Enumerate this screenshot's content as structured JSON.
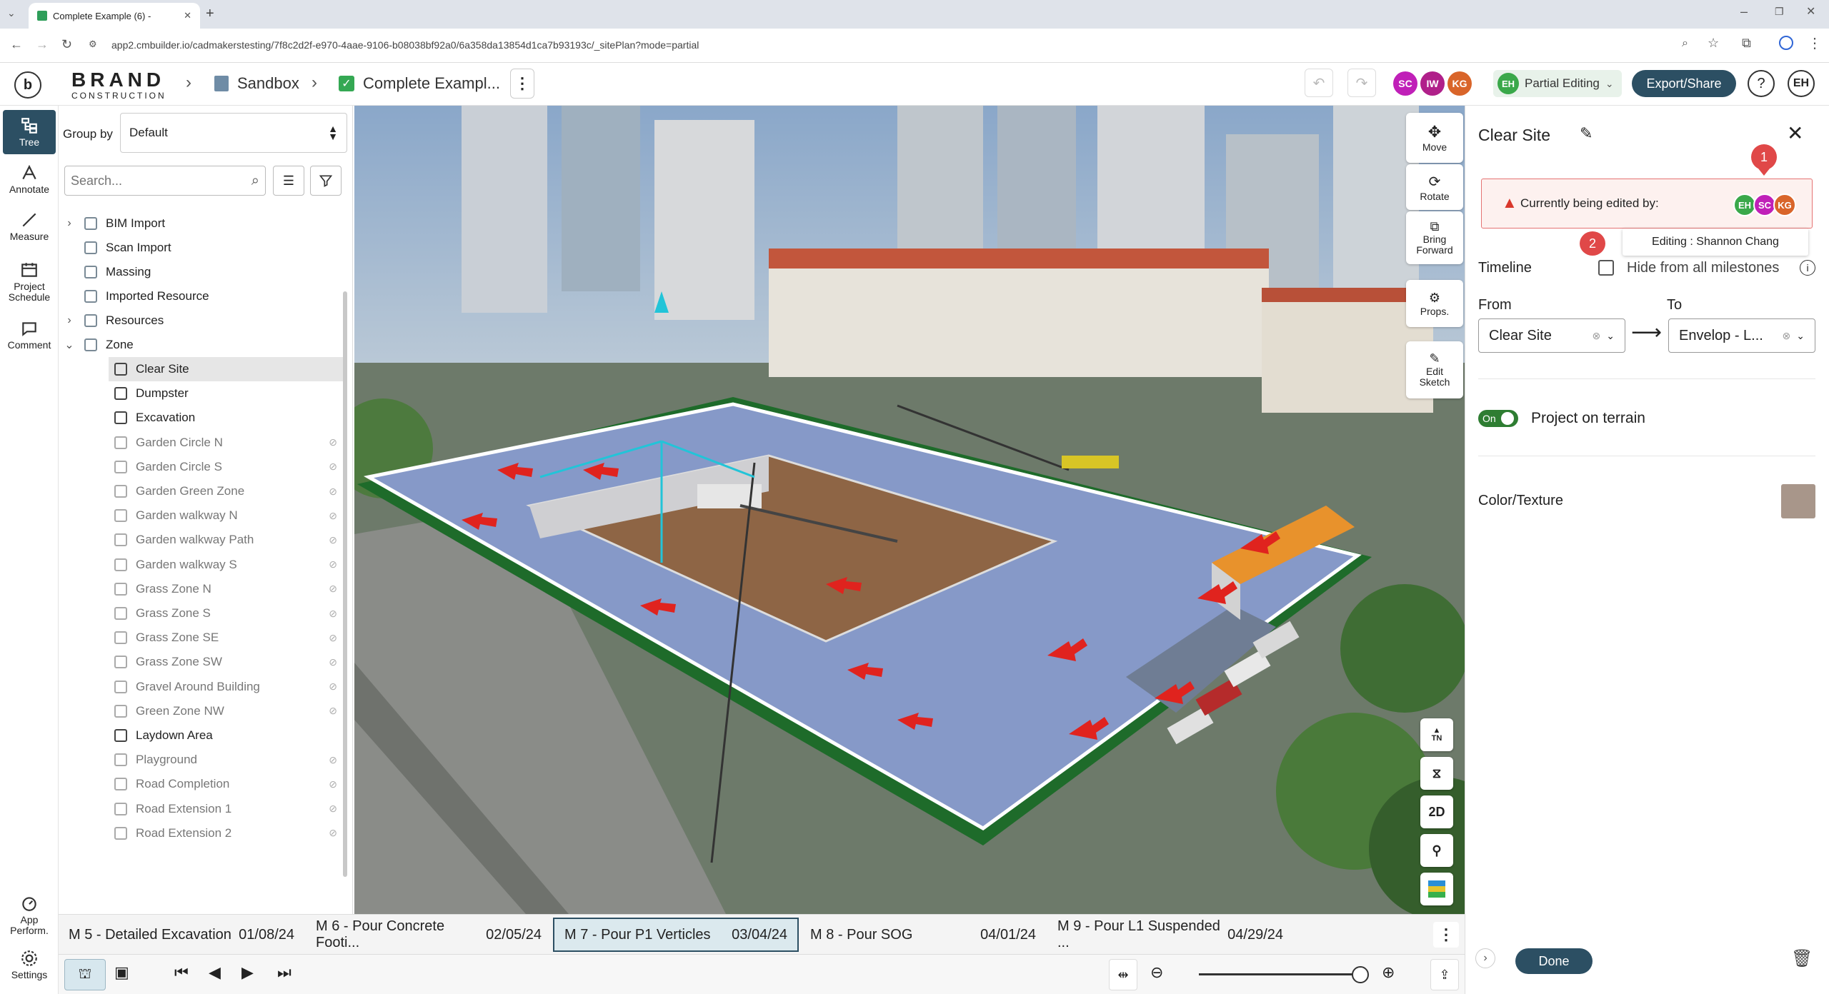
{
  "browser": {
    "tab_title": "Complete Example (6) -",
    "url": "app2.cmbuilder.io/cadmakerstesting/7f8c2d2f-e970-4aae-9106-b08038bf92a0/6a358da13854d1ca7b93193c/_sitePlan?mode=partial"
  },
  "header": {
    "logo_top": "BRAND",
    "logo_bottom": "CONSTRUCTION",
    "crumb1": "Sandbox",
    "crumb2": "Complete Exampl...",
    "avatars": [
      "SC",
      "IW",
      "KG"
    ],
    "editing_mode_initials": "EH",
    "editing_mode_label": "Partial Editing",
    "export_label": "Export/Share",
    "help_label": "?",
    "user_initials": "EH"
  },
  "rail": {
    "tree": "Tree",
    "annotate": "Annotate",
    "measure": "Measure",
    "schedule": "Project Schedule",
    "comment": "Comment",
    "perf": "App Perform.",
    "settings": "Settings"
  },
  "tree": {
    "group_by_label": "Group by",
    "group_by_value": "Default",
    "search_placeholder": "Search...",
    "top_items": [
      {
        "label": "BIM Import",
        "expand": true
      },
      {
        "label": "Scan Import",
        "expand": false
      },
      {
        "label": "Massing",
        "expand": false
      },
      {
        "label": "Imported Resource",
        "expand": false
      },
      {
        "label": "Resources",
        "expand": true
      },
      {
        "label": "Zone",
        "expand": true
      }
    ],
    "zone_children": [
      {
        "label": "Clear Site",
        "dim": false,
        "selected": true
      },
      {
        "label": "Dumpster",
        "dim": false
      },
      {
        "label": "Excavation",
        "dim": false
      },
      {
        "label": "Garden Circle N",
        "dim": true
      },
      {
        "label": "Garden Circle S",
        "dim": true
      },
      {
        "label": "Garden Green Zone",
        "dim": true
      },
      {
        "label": "Garden walkway N",
        "dim": true
      },
      {
        "label": "Garden walkway Path",
        "dim": true
      },
      {
        "label": "Garden walkway S",
        "dim": true
      },
      {
        "label": "Grass Zone N",
        "dim": true
      },
      {
        "label": "Grass Zone S",
        "dim": true
      },
      {
        "label": "Grass Zone SE",
        "dim": true
      },
      {
        "label": "Grass Zone SW",
        "dim": true
      },
      {
        "label": "Gravel Around Building",
        "dim": true
      },
      {
        "label": "Green Zone NW",
        "dim": true
      },
      {
        "label": "Laydown Area",
        "dim": false
      },
      {
        "label": "Playground",
        "dim": true
      },
      {
        "label": "Road Completion",
        "dim": true
      },
      {
        "label": "Road Extension 1",
        "dim": true
      },
      {
        "label": "Road Extension 2",
        "dim": true
      }
    ]
  },
  "tools": {
    "move": "Move",
    "rotate": "Rotate",
    "bring_forward": "Bring Forward",
    "props": "Props.",
    "edit_sketch": "Edit Sketch",
    "tn": "TN",
    "two_d": "2D"
  },
  "panel": {
    "title": "Clear Site",
    "editing_banner": "Currently being edited by:",
    "editor_avatars": [
      "EH",
      "SC",
      "KG"
    ],
    "tooltip": "Editing : Shannon Chang",
    "marker1": "1",
    "marker2": "2",
    "timeline_label": "Timeline",
    "hide_label": "Hide from all milestones",
    "from_label": "From",
    "to_label": "To",
    "from_value": "Clear Site",
    "to_value": "Envelop - L...",
    "toggle_label": "On",
    "terrain_label": "Project on terrain",
    "color_label": "Color/Texture",
    "done_label": "Done"
  },
  "milestones": [
    {
      "name": "M 5 - Detailed Excavation",
      "date": "01/08/24",
      "active": false
    },
    {
      "name": "M 6 - Pour Concrete Footi...",
      "date": "02/05/24",
      "active": false
    },
    {
      "name": "M 7 - Pour P1 Verticles",
      "date": "03/04/24",
      "active": true
    },
    {
      "name": "M 8 - Pour SOG",
      "date": "04/01/24",
      "active": false
    },
    {
      "name": "M 9 - Pour L1 Suspended ...",
      "date": "04/29/24",
      "active": false
    }
  ],
  "colors": {
    "accent": "#2c4f63",
    "warning_bg": "#fdf1ef",
    "warning_border": "#e57373",
    "marker": "#e04848",
    "avatar_sc": "#c020b8",
    "avatar_iw": "#b0208a",
    "avatar_kg": "#d9652a",
    "avatar_eh": "#3aa84a",
    "toggle_green": "#2e7d32"
  },
  "icons": [
    "back-icon",
    "forward-icon",
    "reload-icon",
    "tree-icon",
    "annotate-icon",
    "measure-icon",
    "schedule-icon",
    "comment-icon",
    "perf-icon",
    "settings-icon",
    "search-icon",
    "sort-icon",
    "filter-icon",
    "cube-icon",
    "eye-off-icon",
    "move-icon",
    "rotate-icon",
    "bring-forward-icon",
    "props-icon",
    "edit-sketch-icon",
    "north-icon",
    "compare-icon",
    "paint-icon",
    "layers-icon",
    "undo-icon",
    "redo-icon",
    "pencil-icon",
    "close-icon",
    "warning-icon",
    "info-icon",
    "trash-icon",
    "zoom-in-icon",
    "zoom-out-icon",
    "fit-icon",
    "play-icon",
    "step-back-icon",
    "skip-start-icon",
    "skip-end-icon",
    "export-icon",
    "more-icon"
  ]
}
